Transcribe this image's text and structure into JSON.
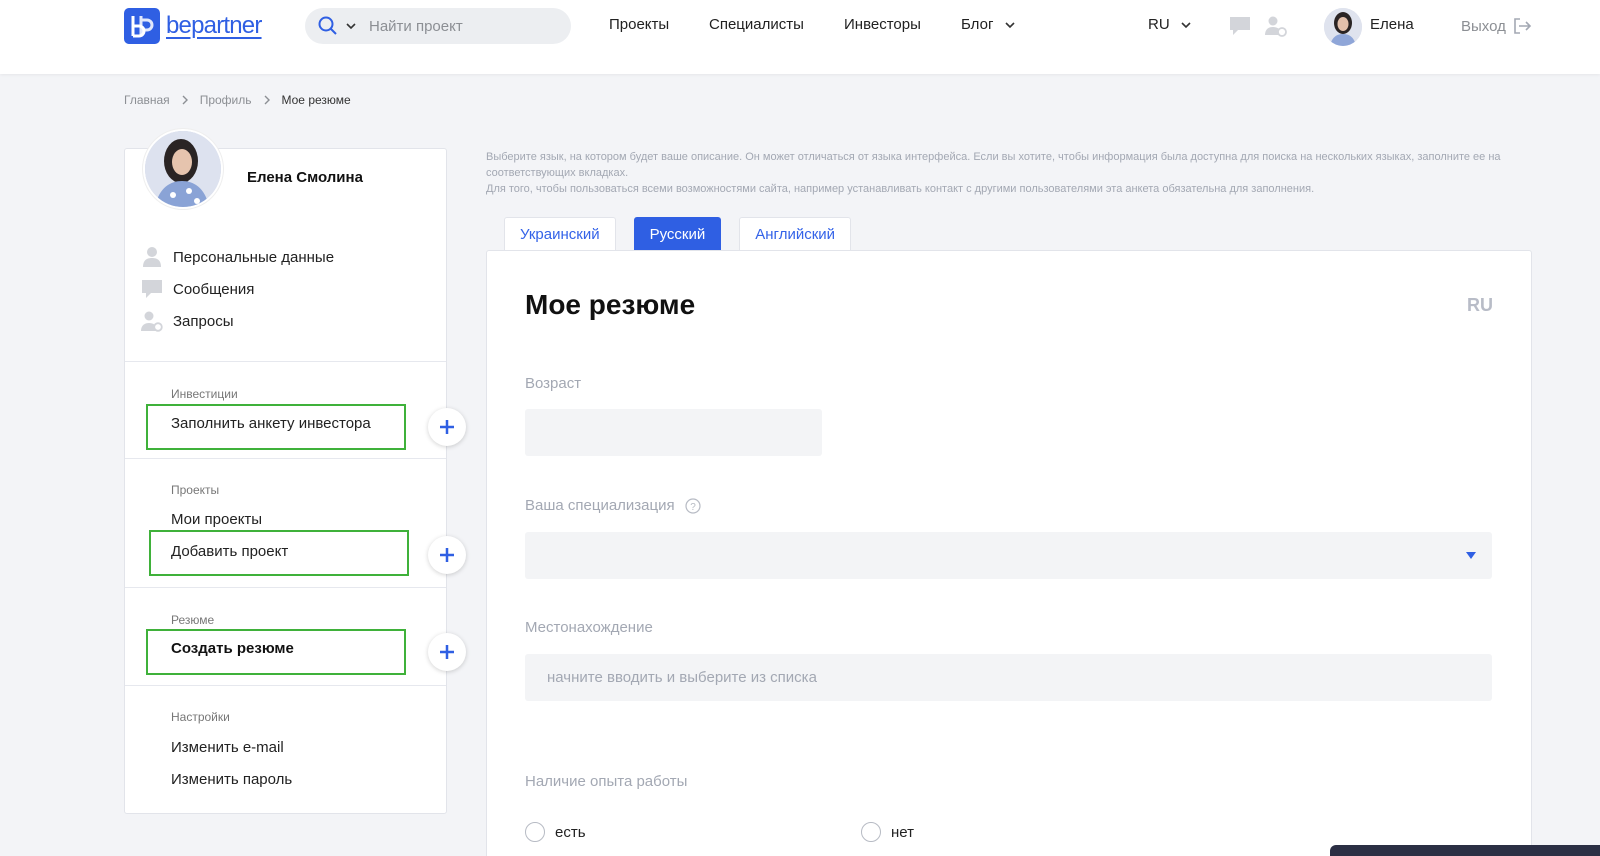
{
  "header": {
    "logo_text": "bepartner",
    "search_placeholder": "Найти проект",
    "nav": [
      "Проекты",
      "Специалисты",
      "Инвесторы",
      "Блог"
    ],
    "lang": "RU",
    "user_name": "Елена",
    "logout_label": "Выход"
  },
  "breadcrumb": [
    "Главная",
    "Профиль",
    "Мое резюме"
  ],
  "sidebar": {
    "full_name": "Елена Смолина",
    "menu": [
      "Персональные данные",
      "Сообщения",
      "Запросы"
    ],
    "sections": {
      "investments": {
        "label": "Инвестиции",
        "link": "Заполнить анкету инвестора"
      },
      "projects": {
        "label": "Проекты",
        "links": [
          "Мои проекты",
          "Добавить проект"
        ]
      },
      "resume": {
        "label": "Резюме",
        "link": "Создать резюме"
      },
      "settings": {
        "label": "Настройки",
        "links": [
          "Изменить e-mail",
          "Изменить пароль"
        ]
      }
    }
  },
  "main": {
    "hint_line1": "Выберите язык, на котором будет ваше описание. Он может отличаться от языка интерфейса. Если вы хотите, чтобы информация была доступна для поиска на нескольких языках, заполните ее на соответствующих вкладках.",
    "hint_line2": "Для того, чтобы пользоваться всеми возможностями сайта, например устанавливать контакт с другими пользователями эта анкета обязательна для заполнения.",
    "tabs": [
      "Украинский",
      "Русский",
      "Английский"
    ],
    "active_tab": "Русский",
    "title": "Мое резюме",
    "lang_badge": "RU",
    "fields": {
      "age_label": "Возраст",
      "age_value": "",
      "spec_label": "Ваша специализация",
      "spec_value": "",
      "location_label": "Местонахождение",
      "location_placeholder": "начните вводить и выберите из списка",
      "experience_label": "Наличие опыта работы",
      "experience_options": [
        "есть",
        "нет"
      ]
    }
  },
  "colors": {
    "brand": "#2f5fe3",
    "highlight": "#3fb13a",
    "muted": "#a3a8b3"
  }
}
